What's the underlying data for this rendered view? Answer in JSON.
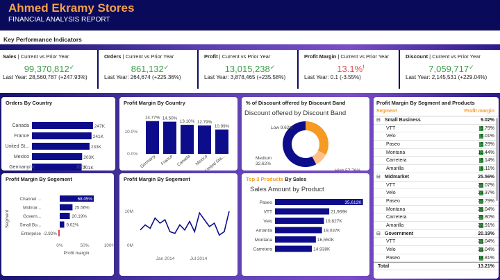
{
  "header": {
    "title": "Ahmed Ekramy Stores",
    "subtitle": "FINANCIAL ANALYSIS REPORT"
  },
  "kpi_section": {
    "title": "Key Performance Indicators"
  },
  "kpis": [
    {
      "label": "Sales",
      "caption": " | Current vs Prior Year",
      "value": "99,370,812",
      "mark": "✓",
      "last_year": "Last Year: 28,560,787 (+247.93%)",
      "status": "good"
    },
    {
      "label": "Orders",
      "caption": " | Current vs Prior Year",
      "value": "861,132",
      "mark": "✓",
      "last_year": "Last Year: 264,674 (+225.36%)",
      "status": "good"
    },
    {
      "label": "Profit",
      "caption": " | Current vs Prior Year",
      "value": "13,015,238",
      "mark": "✓",
      "last_year": "Last Year: 3,878,465 (+235.58%)",
      "status": "good"
    },
    {
      "label": "Profit Margin",
      "caption": " | Current vs Prior Year",
      "value": "13.1%",
      "mark": "!",
      "last_year": "Last Year: 0.1 (-3.55%)",
      "status": "bad"
    },
    {
      "label": "Discount",
      "caption": " | Current vs Prior Year",
      "value": "7,059,717",
      "mark": "✓",
      "last_year": "Last Year: 2,145,531 (+229.04%)",
      "status": "good"
    }
  ],
  "panels": {
    "orders_by_country": "Orders By Country",
    "pm_by_country": "Profit Margin By Country",
    "discount_band": "% of Discount offered by Discount Band",
    "pm_by_segment": "Profit Margin By Segement",
    "pm_by_segment_time": "Profit Margin By Segement",
    "top_products_prefix": "Top 3 Products",
    "top_products_suffix": " By Sales",
    "segment_products": "Profit Margin By Segment and Products"
  },
  "colors": {
    "navy": "#0a0a5a",
    "bar": "#0d0d8c",
    "orange": "#f5a04b",
    "green": "#3a9b46",
    "red": "#e0474c"
  },
  "chart_data": [
    {
      "id": "orders_by_country",
      "type": "bar",
      "orientation": "horizontal",
      "categories": [
        "Canada",
        "France",
        "United St...",
        "Mexico",
        "Germany"
      ],
      "values": [
        247,
        241,
        233,
        203,
        201
      ],
      "labels": [
        "247K",
        "241K",
        "233K",
        "203K",
        "201K"
      ],
      "ticks": [
        "0K",
        "200K"
      ],
      "xlim": [
        0,
        250
      ]
    },
    {
      "id": "pm_by_country",
      "type": "bar",
      "categories": [
        "Germany",
        "France",
        "Canada",
        "Mexico",
        "United Sta..."
      ],
      "values": [
        14.77,
        14.5,
        13.1,
        12.79,
        10.99
      ],
      "labels": [
        "14.77%",
        "14.50%",
        "13.10%",
        "12.79%",
        "10.99%"
      ],
      "yticks": [
        "0.0%",
        "10.0%"
      ],
      "ylim": [
        0,
        15
      ]
    },
    {
      "id": "discount_band",
      "type": "pie",
      "donut": true,
      "title": "Discount offered by Discount Band",
      "slices": [
        {
          "name": "High",
          "value": 57.76,
          "label": "High 57.76%",
          "color": "#0d0d8c"
        },
        {
          "name": "Medium",
          "value": 32.62,
          "label": "Medium 32.62%",
          "color": "#f59a23"
        },
        {
          "name": "Low",
          "value": 9.62,
          "label": "Low 9.62%",
          "color": "#ffc18a"
        }
      ]
    },
    {
      "id": "pm_by_segment",
      "type": "bar",
      "orientation": "horizontal",
      "categories": [
        "Channel ...",
        "Midmar...",
        "Govern...",
        "Small Bu...",
        "Enterprise"
      ],
      "values": [
        68.05,
        25.56,
        20.19,
        9.02,
        -2.92
      ],
      "labels": [
        "68.05%",
        "25.56%",
        "20.19%",
        "9.02%",
        "-2.92%"
      ],
      "ticks": [
        "0%",
        "50%",
        "100%"
      ],
      "xlim": [
        -5,
        100
      ],
      "xlabel": "Profit margin",
      "ylabel": "Segment"
    },
    {
      "id": "pm_by_segment_time",
      "type": "line",
      "values": [
        4.5,
        6.0,
        5.0,
        8.0,
        6.5,
        7.5,
        4.0,
        3.5,
        6.0,
        4.5,
        7.0,
        4.0,
        9.5,
        7.5,
        5.5,
        6.5,
        3.0,
        4.0,
        10.0
      ],
      "yticks": [
        "0M",
        "10M"
      ],
      "ylim": [
        0,
        13
      ],
      "xticks": [
        "Jan 2014",
        "Jul 2014"
      ]
    },
    {
      "id": "top_products",
      "type": "bar",
      "orientation": "horizontal",
      "title": "Sales Amount by Product",
      "categories": [
        "Paseo",
        "VTT",
        "Velo",
        "Amarilla",
        "Montana",
        "Carretera"
      ],
      "values": [
        35612,
        21969,
        19827,
        19037,
        16550,
        14938
      ],
      "labels": [
        "35,612K",
        "21,969K",
        "19,827K",
        "19,037K",
        "16,550K",
        "14,938K"
      ],
      "xlim": [
        0,
        36000
      ]
    }
  ],
  "segment_table": {
    "headers": [
      "Segment",
      "Profit margin"
    ],
    "rows": [
      {
        "type": "group",
        "name": "Small Business",
        "value": "9.02%"
      },
      {
        "type": "item",
        "name": "VTT",
        "value": "9.79%"
      },
      {
        "type": "item",
        "name": "Velo",
        "value": "6.01%"
      },
      {
        "type": "item",
        "name": "Paseo",
        "value": "9.29%"
      },
      {
        "type": "item",
        "name": "Montana",
        "value": "10.44%"
      },
      {
        "type": "item",
        "name": "Carretera",
        "value": "8.14%"
      },
      {
        "type": "item",
        "name": "Amarilla",
        "value": "8.11%"
      },
      {
        "type": "group",
        "name": "Midmarket",
        "value": "25.56%"
      },
      {
        "type": "item",
        "name": "VTT",
        "value": "25.07%"
      },
      {
        "type": "item",
        "name": "Velo",
        "value": "23.37%"
      },
      {
        "type": "item",
        "name": "Paseo",
        "value": "25.79%"
      },
      {
        "type": "item",
        "name": "Montana",
        "value": "26.04%"
      },
      {
        "type": "item",
        "name": "Carretera",
        "value": "25.80%"
      },
      {
        "type": "item",
        "name": "Amarilla",
        "value": "22.91%"
      },
      {
        "type": "group",
        "name": "Government",
        "value": "20.19%"
      },
      {
        "type": "item",
        "name": "VTT",
        "value": "21.04%"
      },
      {
        "type": "item",
        "name": "Velo",
        "value": "21.04%"
      },
      {
        "type": "item",
        "name": "Paseo",
        "value": "18.81%"
      },
      {
        "type": "total",
        "name": "Total",
        "value": "13.21%"
      }
    ]
  }
}
